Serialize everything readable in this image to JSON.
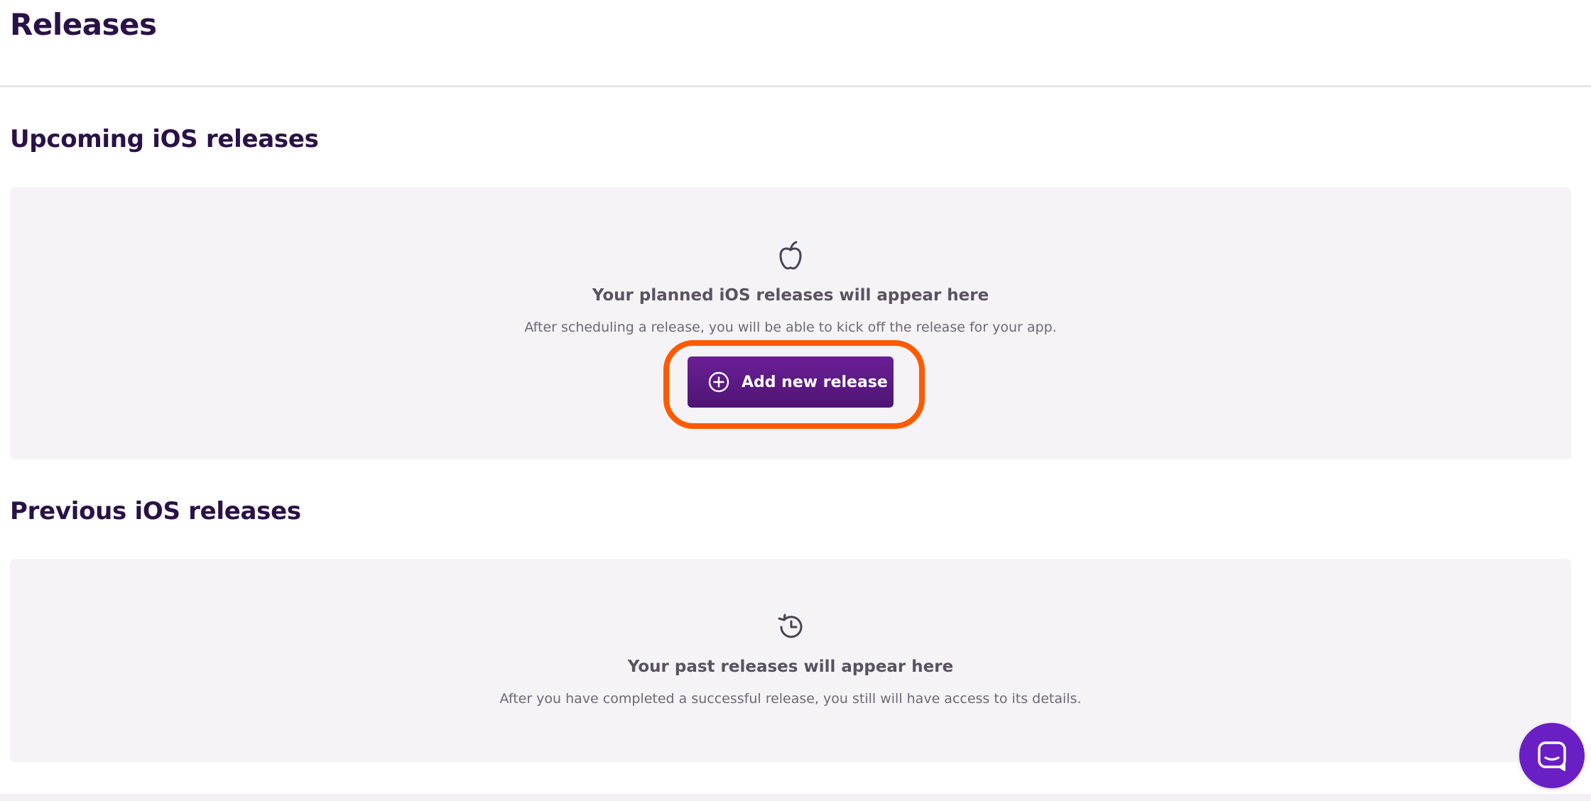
{
  "page": {
    "title": "Releases"
  },
  "upcoming": {
    "heading": "Upcoming iOS releases",
    "icon": "apple-icon",
    "empty_title": "Your planned iOS releases will appear here",
    "empty_text": "After scheduling a release, you will be able to kick off the release for your app.",
    "add_button_label": "Add new release",
    "add_button_icon": "plus-circle-icon"
  },
  "previous": {
    "heading": "Previous iOS releases",
    "icon": "history-icon",
    "empty_title": "Your past releases will appear here",
    "empty_text": "After you have completed a successful release, you still will have access to its details."
  },
  "chat": {
    "icon": "chat-icon"
  },
  "colors": {
    "heading": "#2a1246",
    "button": "#5c1a86",
    "highlight": "#ff5a00",
    "chat": "#6a1fc4",
    "panel": "#f5f3f6"
  }
}
